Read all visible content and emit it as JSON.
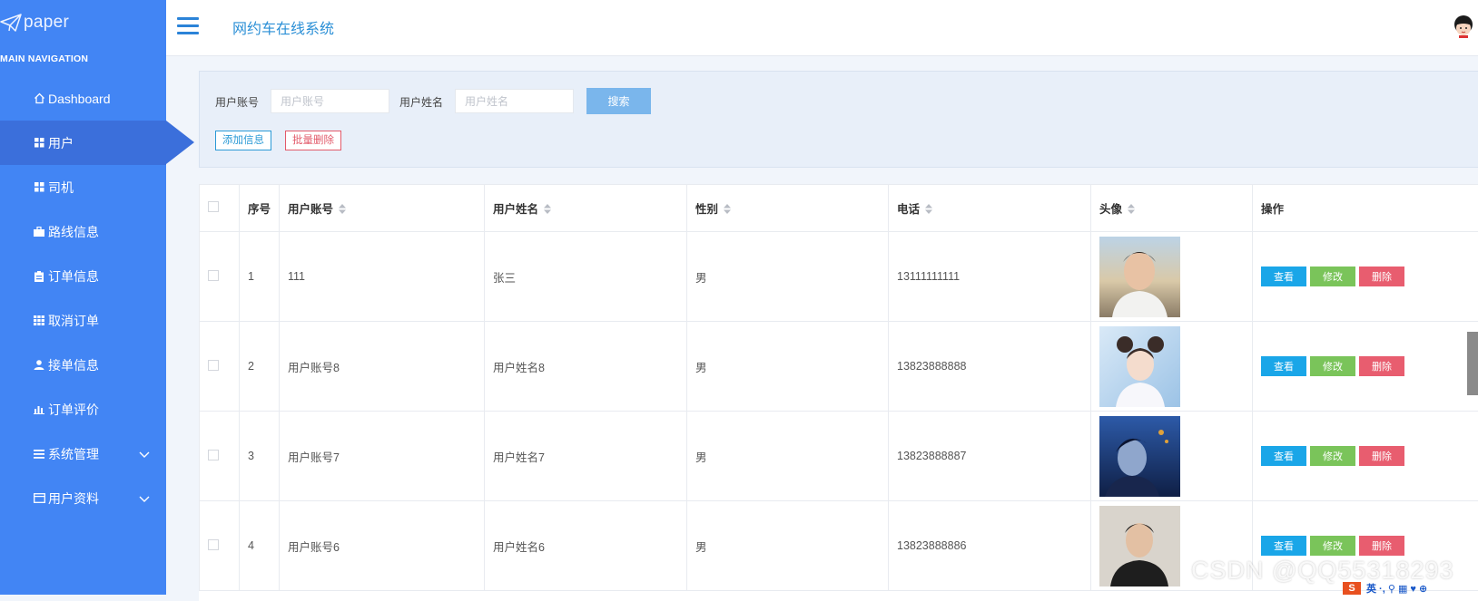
{
  "brand": {
    "name": "paper",
    "logo_icon": "paper-plane-icon"
  },
  "sidebar": {
    "section_title": "MAIN NAVIGATION",
    "items": [
      {
        "label": "Dashboard",
        "icon": "home-icon"
      },
      {
        "label": "用户",
        "icon": "grid-icon",
        "active": true
      },
      {
        "label": "司机",
        "icon": "grid-icon"
      },
      {
        "label": "路线信息",
        "icon": "briefcase-icon"
      },
      {
        "label": "订单信息",
        "icon": "clipboard-icon"
      },
      {
        "label": "取消订单",
        "icon": "grid-large-icon"
      },
      {
        "label": "接单信息",
        "icon": "user-icon"
      },
      {
        "label": "订单评价",
        "icon": "bar-chart-icon"
      },
      {
        "label": "系统管理",
        "icon": "list-icon",
        "expandable": true
      },
      {
        "label": "用户资料",
        "icon": "card-icon",
        "expandable": true
      }
    ]
  },
  "header": {
    "title": "网约车在线系统",
    "avatar_icon": "cartoon-avatar-icon"
  },
  "search": {
    "account_label": "用户账号",
    "account_placeholder": "用户账号",
    "name_label": "用户姓名",
    "name_placeholder": "用户姓名",
    "search_button": "搜索",
    "add_button": "添加信息",
    "batch_delete_button": "批量删除"
  },
  "table": {
    "columns": [
      "序号",
      "用户账号",
      "用户姓名",
      "性别",
      "电话",
      "头像",
      "操作"
    ],
    "actions": {
      "view": "查看",
      "edit": "修改",
      "delete": "删除"
    },
    "rows": [
      {
        "index": "1",
        "account": "111",
        "name": "张三",
        "gender": "男",
        "phone": "13111111111",
        "avatar": "photo-young-man-outdoor"
      },
      {
        "index": "2",
        "account": "用户账号8",
        "name": "用户姓名8",
        "gender": "男",
        "phone": "13823888888",
        "avatar": "photo-girl-with-buns"
      },
      {
        "index": "3",
        "account": "用户账号7",
        "name": "用户姓名7",
        "gender": "男",
        "phone": "13823888887",
        "avatar": "photo-man-blue-tone"
      },
      {
        "index": "4",
        "account": "用户账号6",
        "name": "用户姓名6",
        "gender": "男",
        "phone": "13823888886",
        "avatar": "photo-man-dark-sweater"
      }
    ]
  },
  "watermark": "CSDN @QQ55318293",
  "ime": {
    "badge": "S",
    "text": "英 ·, ⚲ ▦ ♥ ⊕"
  },
  "colors": {
    "sidebar": "#4285f4",
    "sidebar_active": "#3b6fdb",
    "title": "#2b8fd6",
    "search_button": "#7ab6ec",
    "view": "#1aa6e8",
    "edit": "#7ac45a",
    "delete": "#e85d6f"
  }
}
